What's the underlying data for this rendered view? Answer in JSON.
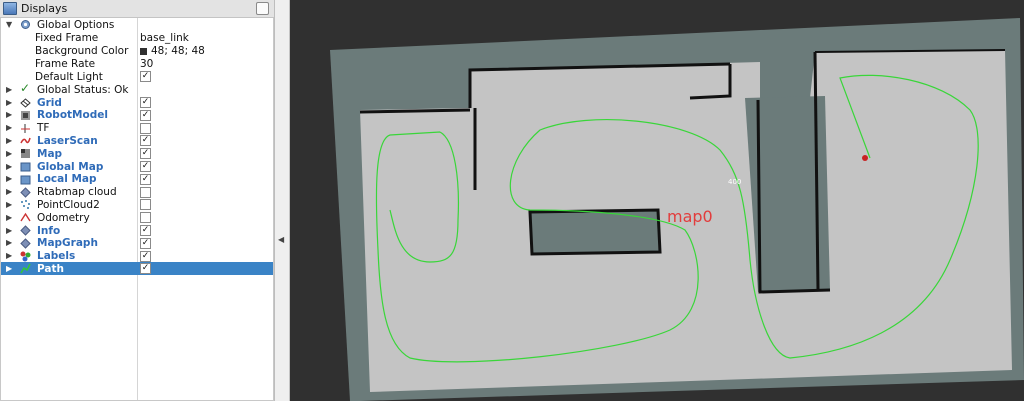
{
  "panel": {
    "title": "Displays"
  },
  "tree": {
    "global_options": {
      "label": "Global Options"
    },
    "fixed_frame": {
      "label": "Fixed Frame",
      "value": "base_link"
    },
    "background_color": {
      "label": "Background Color",
      "value": "48; 48; 48",
      "color": "#303030"
    },
    "frame_rate": {
      "label": "Frame Rate",
      "value": "30"
    },
    "default_light": {
      "label": "Default Light",
      "checked": true
    },
    "global_status": {
      "label": "Global Status: Ok"
    },
    "displays": [
      {
        "label": "Grid",
        "icon": "grid-icon",
        "checked": true,
        "bold": true
      },
      {
        "label": "RobotModel",
        "icon": "robot-model-icon",
        "checked": true,
        "bold": true
      },
      {
        "label": "TF",
        "icon": "tf-icon",
        "checked": false,
        "bold": false
      },
      {
        "label": "LaserScan",
        "icon": "laser-scan-icon",
        "checked": true,
        "bold": true
      },
      {
        "label": "Map",
        "icon": "map-icon",
        "checked": true,
        "bold": true
      },
      {
        "label": "Global Map",
        "icon": "folder-icon",
        "checked": true,
        "bold": true
      },
      {
        "label": "Local Map",
        "icon": "folder-icon",
        "checked": true,
        "bold": true
      },
      {
        "label": "Rtabmap cloud",
        "icon": "diamond-icon",
        "checked": false,
        "bold": false
      },
      {
        "label": "PointCloud2",
        "icon": "point-cloud-icon",
        "checked": false,
        "bold": false
      },
      {
        "label": "Odometry",
        "icon": "odometry-icon",
        "checked": false,
        "bold": false
      },
      {
        "label": "Info",
        "icon": "diamond-icon",
        "checked": true,
        "bold": true
      },
      {
        "label": "MapGraph",
        "icon": "diamond-icon",
        "checked": true,
        "bold": true
      },
      {
        "label": "Labels",
        "icon": "labels-icon",
        "checked": true,
        "bold": true
      },
      {
        "label": "Path",
        "icon": "path-icon",
        "checked": true,
        "bold": true,
        "selected": true
      }
    ]
  },
  "view": {
    "map_label": "map0",
    "node_label": "400",
    "colors": {
      "background": "#303030",
      "unknown": "#6b7b7a",
      "free": "#c4c4c4",
      "wall": "#111111",
      "path": "#39d639",
      "label": "#e23c3c"
    }
  }
}
